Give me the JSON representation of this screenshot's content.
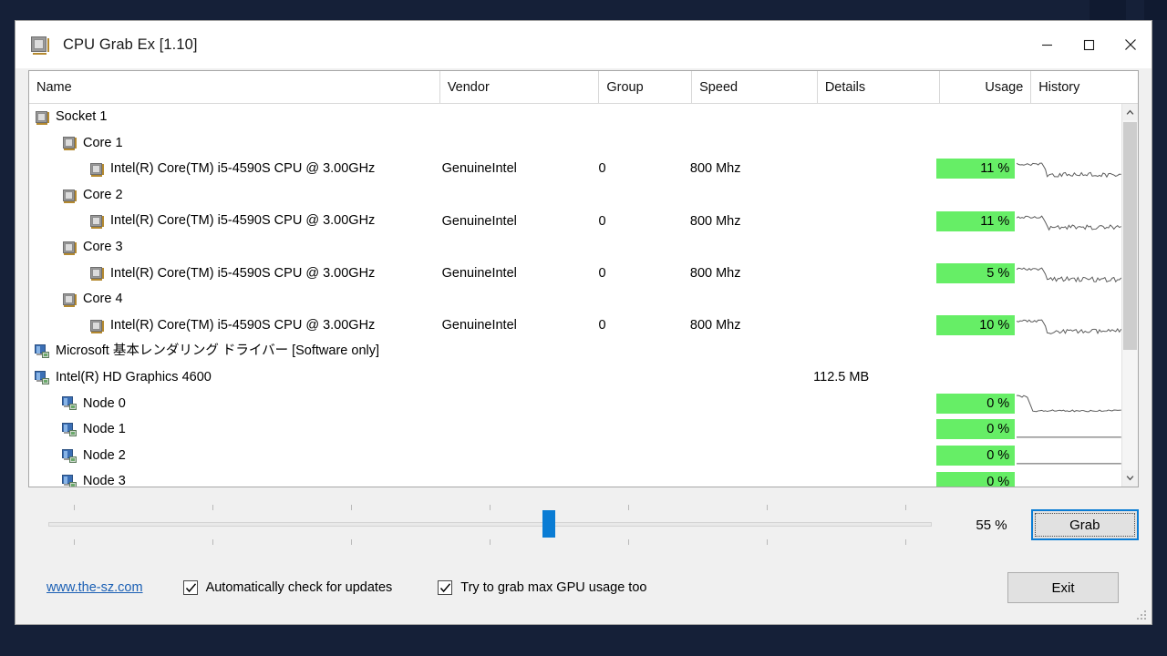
{
  "window": {
    "title": "CPU Grab Ex [1.10]",
    "icon": "cpu-chip-icon",
    "minimize": "─",
    "maximize": "□",
    "close": "✕"
  },
  "columns": [
    {
      "key": "name",
      "label": "Name"
    },
    {
      "key": "vendor",
      "label": "Vendor"
    },
    {
      "key": "group",
      "label": "Group"
    },
    {
      "key": "speed",
      "label": "Speed"
    },
    {
      "key": "details",
      "label": "Details"
    },
    {
      "key": "usage",
      "label": "Usage"
    },
    {
      "key": "history",
      "label": "History"
    }
  ],
  "rows": [
    {
      "indent": 0,
      "icon": "cpu-chip-icon",
      "name": "Socket 1",
      "vendor": "",
      "group": "",
      "speed": "",
      "details": "",
      "usage": "",
      "history": false
    },
    {
      "indent": 1,
      "icon": "cpu-chip-icon",
      "name": "Core 1",
      "vendor": "",
      "group": "",
      "speed": "",
      "details": "",
      "usage": "",
      "history": false
    },
    {
      "indent": 2,
      "icon": "cpu-chip-icon",
      "name": "Intel(R) Core(TM) i5-4590S CPU @ 3.00GHz",
      "vendor": "GenuineIntel",
      "group": "0",
      "speed": "800 Mhz",
      "details": "",
      "usage": "11 %",
      "history": true
    },
    {
      "indent": 1,
      "icon": "cpu-chip-icon",
      "name": "Core 2",
      "vendor": "",
      "group": "",
      "speed": "",
      "details": "",
      "usage": "",
      "history": false
    },
    {
      "indent": 2,
      "icon": "cpu-chip-icon",
      "name": "Intel(R) Core(TM) i5-4590S CPU @ 3.00GHz",
      "vendor": "GenuineIntel",
      "group": "0",
      "speed": "800 Mhz",
      "details": "",
      "usage": "11 %",
      "history": true
    },
    {
      "indent": 1,
      "icon": "cpu-chip-icon",
      "name": "Core 3",
      "vendor": "",
      "group": "",
      "speed": "",
      "details": "",
      "usage": "",
      "history": false
    },
    {
      "indent": 2,
      "icon": "cpu-chip-icon",
      "name": "Intel(R) Core(TM) i5-4590S CPU @ 3.00GHz",
      "vendor": "GenuineIntel",
      "group": "0",
      "speed": "800 Mhz",
      "details": "",
      "usage": "5 %",
      "history": true
    },
    {
      "indent": 1,
      "icon": "cpu-chip-icon",
      "name": "Core 4",
      "vendor": "",
      "group": "",
      "speed": "",
      "details": "",
      "usage": "",
      "history": false
    },
    {
      "indent": 2,
      "icon": "cpu-chip-icon",
      "name": "Intel(R) Core(TM) i5-4590S CPU @ 3.00GHz",
      "vendor": "GenuineIntel",
      "group": "0",
      "speed": "800 Mhz",
      "details": "",
      "usage": "10 %",
      "history": true
    },
    {
      "indent": 0,
      "icon": "gpu-display-icon",
      "name": "Microsoft 基本レンダリング ドライバー [Software only]",
      "vendor": "",
      "group": "",
      "speed": "",
      "details": "",
      "usage": "",
      "history": false
    },
    {
      "indent": 0,
      "icon": "gpu-display-icon",
      "name": "Intel(R) HD Graphics 4600",
      "vendor": "",
      "group": "",
      "speed": "",
      "details": "112.5 MB",
      "usage": "",
      "history": false
    },
    {
      "indent": 1,
      "icon": "gpu-display-icon",
      "name": "Node 0",
      "vendor": "",
      "group": "",
      "speed": "",
      "details": "",
      "usage": "0 %",
      "history": true
    },
    {
      "indent": 1,
      "icon": "gpu-display-icon",
      "name": "Node 1",
      "vendor": "",
      "group": "",
      "speed": "",
      "details": "",
      "usage": "0 %",
      "history": true
    },
    {
      "indent": 1,
      "icon": "gpu-display-icon",
      "name": "Node 2",
      "vendor": "",
      "group": "",
      "speed": "",
      "details": "",
      "usage": "0 %",
      "history": true
    },
    {
      "indent": 1,
      "icon": "gpu-display-icon",
      "name": "Node 3",
      "vendor": "",
      "group": "",
      "speed": "",
      "details": "",
      "usage": "0 %",
      "history": true
    }
  ],
  "slider": {
    "value": 55,
    "value_label": "55 %",
    "min": 0,
    "max": 100,
    "tick_count": 7
  },
  "buttons": {
    "grab": "Grab",
    "exit": "Exit"
  },
  "footer": {
    "link": "www.the-sz.com",
    "checkbox_updates": {
      "label": "Automatically check for updates",
      "checked": true
    },
    "checkbox_gpu": {
      "label": "Try to grab max GPU usage too",
      "checked": true
    }
  },
  "colors": {
    "usage_green": "#66ee66",
    "accent_blue": "#0a7cd4",
    "link_blue": "#1a5fb4",
    "desktop": "#152038"
  }
}
